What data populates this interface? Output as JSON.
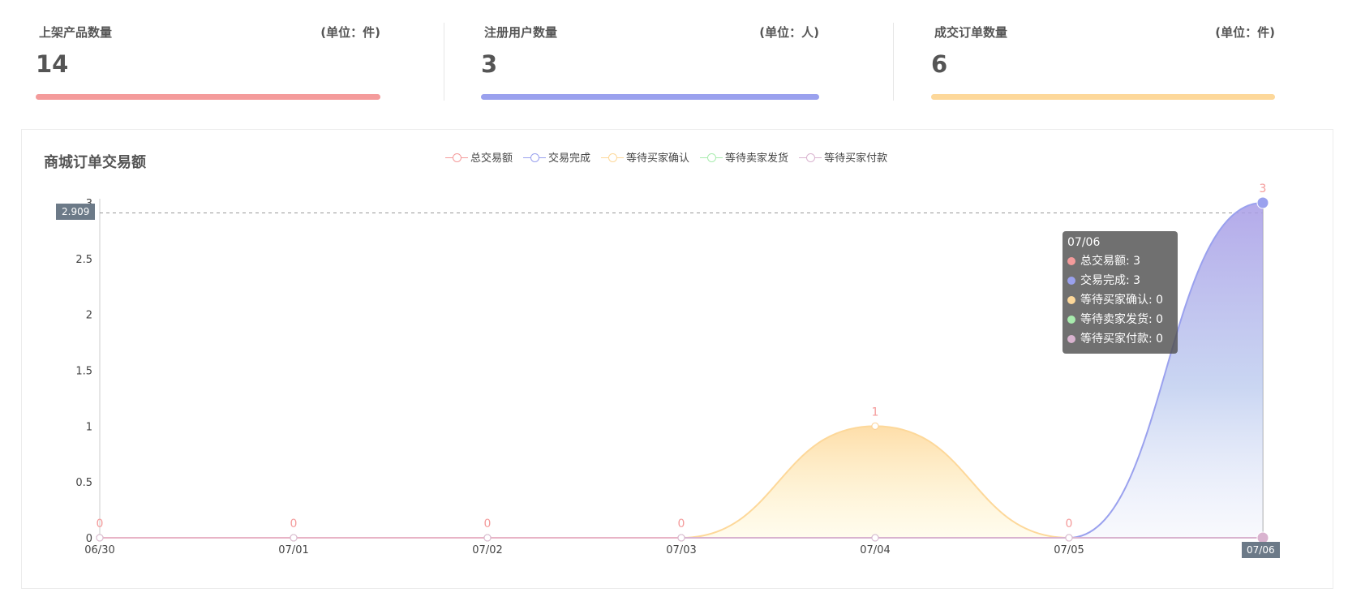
{
  "stats": [
    {
      "title": "上架产品数量",
      "unit": "(单位：件)",
      "value": "14",
      "color": "#f49b9b"
    },
    {
      "title": "注册用户数量",
      "unit": "(单位：人)",
      "value": "3",
      "color": "#9aa1ee"
    },
    {
      "title": "成交订单数量",
      "unit": "(单位：件)",
      "value": "6",
      "color": "#fdd89a"
    }
  ],
  "chart_data": {
    "type": "area",
    "title": "商城订单交易额",
    "categories": [
      "06/30",
      "07/01",
      "07/02",
      "07/03",
      "07/04",
      "07/05",
      "07/06"
    ],
    "y_ticks": [
      "0",
      "0.5",
      "1",
      "1.5",
      "2",
      "2.5",
      "3"
    ],
    "ylim": [
      0,
      3
    ],
    "legend_position": "top-center",
    "series": [
      {
        "name": "总交易额",
        "color": "#f49b9b",
        "values": [
          0,
          0,
          0,
          0,
          1,
          0,
          3
        ]
      },
      {
        "name": "交易完成",
        "color": "#9aa1ee",
        "values": [
          0,
          0,
          0,
          0,
          0,
          0,
          3
        ]
      },
      {
        "name": "等待买家确认",
        "color": "#fdd89a",
        "values": [
          0,
          0,
          0,
          0,
          1,
          0,
          0
        ]
      },
      {
        "name": "等待卖家发货",
        "color": "#a8ecae",
        "values": [
          0,
          0,
          0,
          0,
          0,
          0,
          0
        ]
      },
      {
        "name": "等待买家付款",
        "color": "#d9b3cf",
        "values": [
          0,
          0,
          0,
          0,
          0,
          0,
          0
        ]
      }
    ],
    "point_labels": [
      "0",
      "0",
      "0",
      "0",
      "1",
      "0",
      "3"
    ]
  },
  "pointer": {
    "y_value": "2.909",
    "x_value": "07/06"
  },
  "tooltip": {
    "header": "07/06",
    "rows": [
      {
        "label": "总交易额: 3",
        "color": "#f49b9b"
      },
      {
        "label": "交易完成: 3",
        "color": "#9aa1ee"
      },
      {
        "label": "等待买家确认: 0",
        "color": "#fdd89a"
      },
      {
        "label": "等待卖家发货: 0",
        "color": "#a8ecae"
      },
      {
        "label": "等待买家付款: 0",
        "color": "#d9b3cf"
      }
    ]
  }
}
